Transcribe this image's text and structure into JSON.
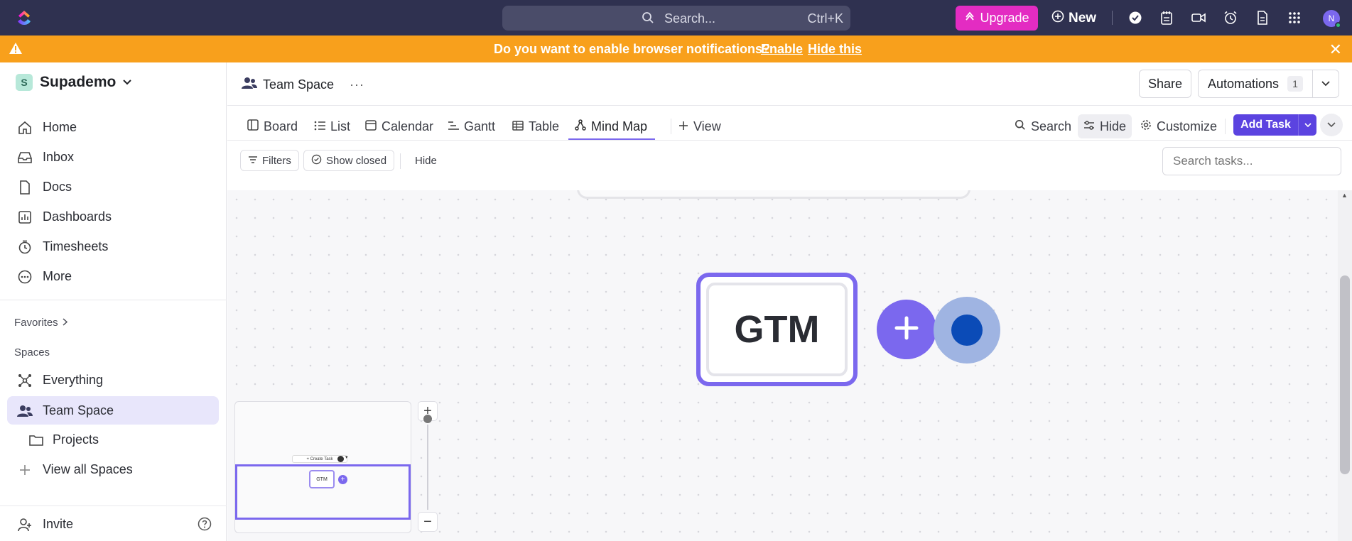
{
  "topbar": {
    "search_placeholder": "Search...",
    "search_shortcut": "Ctrl+K",
    "upgrade_label": "Upgrade",
    "new_label": "New",
    "avatar_initial": "N"
  },
  "notification": {
    "message": "Do you want to enable browser notifications?",
    "enable_label": "Enable",
    "hide_label": "Hide this"
  },
  "sidebar": {
    "workspace_initial": "S",
    "workspace_name": "Supademo",
    "nav": [
      {
        "label": "Home"
      },
      {
        "label": "Inbox"
      },
      {
        "label": "Docs"
      },
      {
        "label": "Dashboards"
      },
      {
        "label": "Timesheets"
      },
      {
        "label": "More"
      }
    ],
    "favorites_label": "Favorites",
    "spaces_label": "Spaces",
    "spaces": [
      {
        "label": "Everything"
      },
      {
        "label": "Team Space"
      },
      {
        "label": "Projects"
      },
      {
        "label": "View all Spaces"
      }
    ],
    "invite_label": "Invite"
  },
  "header": {
    "breadcrumb": "Team Space",
    "more": "···",
    "share_label": "Share",
    "automations_label": "Automations",
    "automations_count": "1"
  },
  "tabs": [
    {
      "label": "Board"
    },
    {
      "label": "List"
    },
    {
      "label": "Calendar"
    },
    {
      "label": "Gantt"
    },
    {
      "label": "Table"
    },
    {
      "label": "Mind Map"
    },
    {
      "label": "View"
    }
  ],
  "tab_actions": {
    "search_label": "Search",
    "hide_label": "Hide",
    "customize_label": "Customize",
    "add_task_label": "Add Task"
  },
  "filters": {
    "filters_label": "Filters",
    "show_closed_label": "Show closed",
    "hide_label": "Hide",
    "search_tasks_placeholder": "Search tasks..."
  },
  "canvas": {
    "node_label": "GTM",
    "minimap_create_label": "+ Create Task",
    "minimap_node_label": "GTM"
  },
  "colors": {
    "accent": "#7b68ee",
    "topbar": "#2f3150",
    "notification": "#f8a01c",
    "upgrade": "#e32cc2"
  }
}
